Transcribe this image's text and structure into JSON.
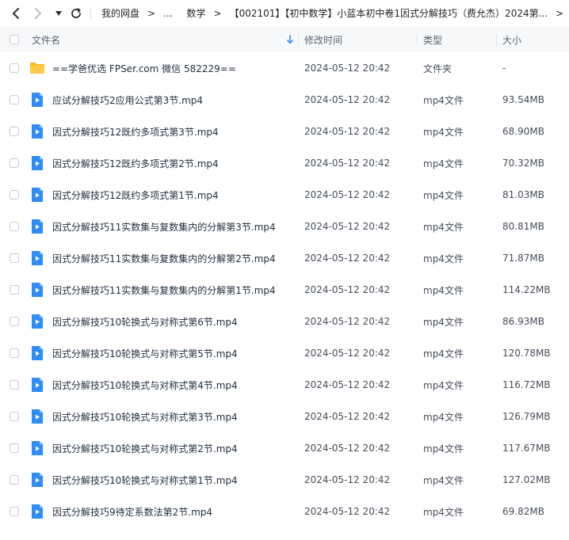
{
  "breadcrumb": {
    "root": "我的网盘",
    "ellipsis": "...",
    "level1": "数学",
    "level2": "【002101】【初中数学】小蓝本初中卷1因式分解技巧（费允杰）2024第..."
  },
  "header": {
    "name_label": "文件名",
    "time_label": "修改时间",
    "type_label": "类型",
    "size_label": "大小"
  },
  "colors": {
    "accent": "#2f8dfa",
    "folder": "#ffb81f",
    "header_bg": "#f7f8fa"
  },
  "files": [
    {
      "name": "==学爸优选 FPSer.com 微信 582229==",
      "time": "2024-05-12 20:42",
      "type": "文件夹",
      "size": "-",
      "icon": "folder-icon"
    },
    {
      "name": "应试分解技巧2应用公式第3节.mp4",
      "time": "2024-05-12 20:42",
      "type": "mp4文件",
      "size": "93.54MB",
      "icon": "video-file-icon"
    },
    {
      "name": "因式分解技巧12既约多项式第3节.mp4",
      "time": "2024-05-12 20:42",
      "type": "mp4文件",
      "size": "68.90MB",
      "icon": "video-file-icon"
    },
    {
      "name": "因式分解技巧12既约多项式第2节.mp4",
      "time": "2024-05-12 20:42",
      "type": "mp4文件",
      "size": "70.32MB",
      "icon": "video-file-icon"
    },
    {
      "name": "因式分解技巧12既约多项式第1节.mp4",
      "time": "2024-05-12 20:42",
      "type": "mp4文件",
      "size": "81.03MB",
      "icon": "video-file-icon"
    },
    {
      "name": "因式分解技巧11实数集与复数集内的分解第3节.mp4",
      "time": "2024-05-12 20:42",
      "type": "mp4文件",
      "size": "80.81MB",
      "icon": "video-file-icon"
    },
    {
      "name": "因式分解技巧11实数集与复数集内的分解第2节.mp4",
      "time": "2024-05-12 20:42",
      "type": "mp4文件",
      "size": "71.87MB",
      "icon": "video-file-icon"
    },
    {
      "name": "因式分解技巧11实数集与复数集内的分解第1节.mp4",
      "time": "2024-05-12 20:42",
      "type": "mp4文件",
      "size": "114.22MB",
      "icon": "video-file-icon"
    },
    {
      "name": "因式分解技巧10轮换式与对称式第6节.mp4",
      "time": "2024-05-12 20:42",
      "type": "mp4文件",
      "size": "86.93MB",
      "icon": "video-file-icon"
    },
    {
      "name": "因式分解技巧10轮换式与对称式第5节.mp4",
      "time": "2024-05-12 20:42",
      "type": "mp4文件",
      "size": "120.78MB",
      "icon": "video-file-icon"
    },
    {
      "name": "因式分解技巧10轮换式与对称式第4节.mp4",
      "time": "2024-05-12 20:42",
      "type": "mp4文件",
      "size": "116.72MB",
      "icon": "video-file-icon"
    },
    {
      "name": "因式分解技巧10轮换式与对称式第3节.mp4",
      "time": "2024-05-12 20:42",
      "type": "mp4文件",
      "size": "126.79MB",
      "icon": "video-file-icon"
    },
    {
      "name": "因式分解技巧10轮换式与对称式第2节.mp4",
      "time": "2024-05-12 20:42",
      "type": "mp4文件",
      "size": "117.67MB",
      "icon": "video-file-icon"
    },
    {
      "name": "因式分解技巧10轮换式与对称式第1节.mp4",
      "time": "2024-05-12 20:42",
      "type": "mp4文件",
      "size": "127.02MB",
      "icon": "video-file-icon"
    },
    {
      "name": "因式分解技巧9待定系数法第2节.mp4",
      "time": "2024-05-12 20:42",
      "type": "mp4文件",
      "size": "69.82MB",
      "icon": "video-file-icon"
    }
  ]
}
